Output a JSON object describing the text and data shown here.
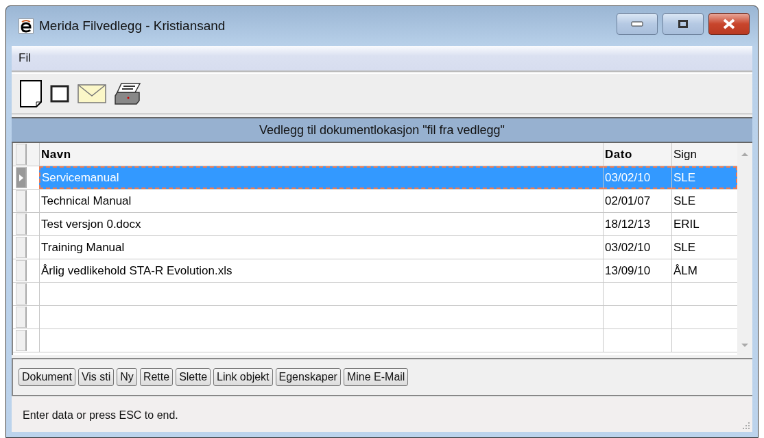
{
  "window": {
    "title": "Merida Filvedlegg - Kristiansand"
  },
  "menu": [
    {
      "label": "Fil"
    }
  ],
  "caption": "Vedlegg til dokumentlokasjon \"fil fra vedlegg\"",
  "table": {
    "columns": [
      "Navn",
      "Dato",
      "Sign"
    ],
    "rows": [
      {
        "cells": [
          "Servicemanual",
          "03/02/10",
          "SLE"
        ],
        "selected": true
      },
      {
        "cells": [
          "Technical Manual",
          "02/01/07",
          "SLE"
        ],
        "selected": false
      },
      {
        "cells": [
          "Test versjon 0.docx",
          "18/12/13",
          "ERIL"
        ],
        "selected": false
      },
      {
        "cells": [
          "Training Manual",
          "03/02/10",
          "SLE"
        ],
        "selected": false
      },
      {
        "cells": [
          "Årlig vedlikehold STA-R Evolution.xls",
          "13/09/10",
          "ÅLM"
        ],
        "selected": false
      }
    ]
  },
  "buttons": [
    "Dokument",
    "Vis sti",
    "Ny",
    "Rette",
    "Slette",
    "Link objekt",
    "Egenskaper",
    "Mine E-Mail"
  ],
  "status_bar": "Enter data or press ESC to end."
}
